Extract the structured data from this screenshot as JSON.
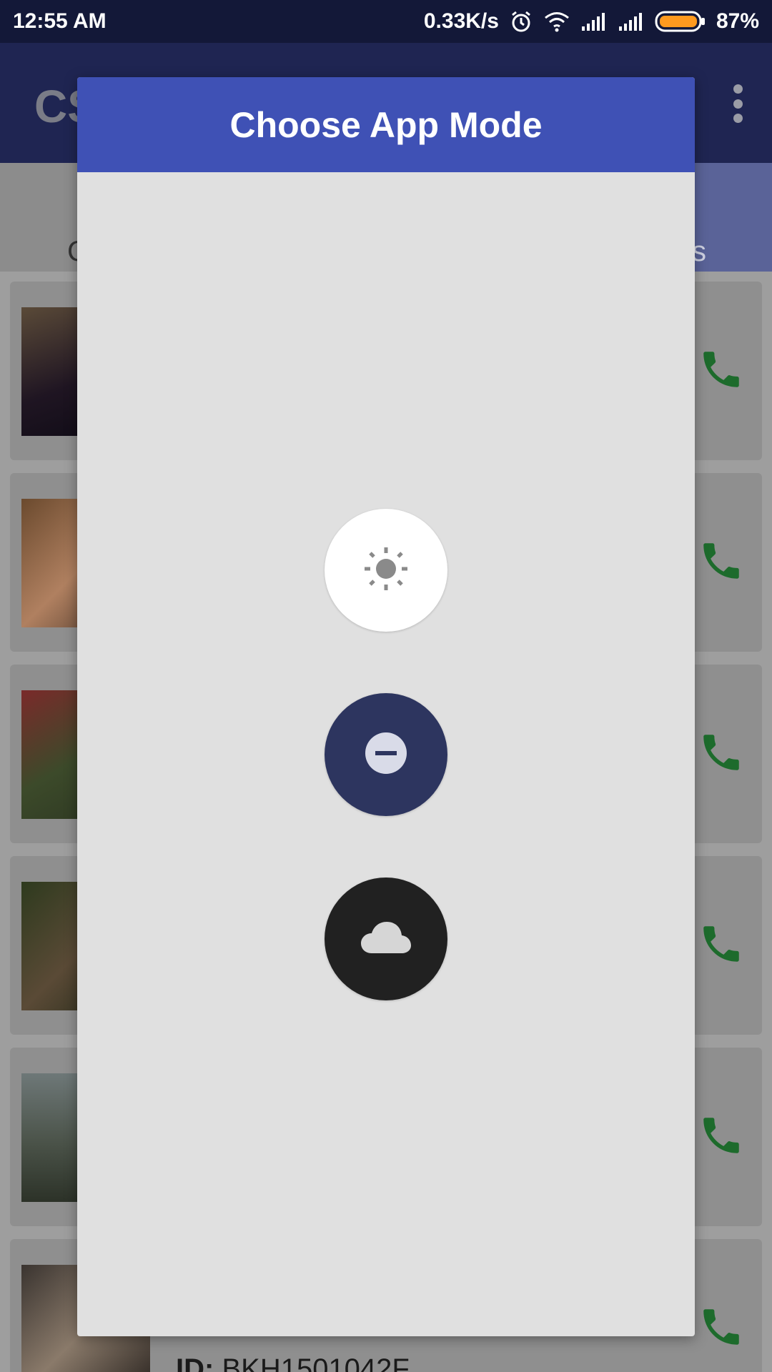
{
  "status_bar": {
    "time": "12:55 AM",
    "speed": "0.33K/s",
    "battery": "87%",
    "icons": [
      "alarm-icon",
      "wifi-icon",
      "signal-icon",
      "signal-icon",
      "battery-icon"
    ]
  },
  "app": {
    "title": "CS",
    "tab_left_fragment": "C",
    "tab_right_fragment": "s",
    "last_contact_id_label": "ID:",
    "last_contact_id_value": "BKH1501042F",
    "call_icon": "phone-icon",
    "accent_color": "#3f51b5",
    "call_color": "#2e7d32"
  },
  "dialog": {
    "title": "Choose App Mode",
    "modes": [
      {
        "name": "light",
        "icon": "sun-icon",
        "background": "#ffffff"
      },
      {
        "name": "do-not-disturb",
        "icon": "minus-circle-icon",
        "background": "#2d355f"
      },
      {
        "name": "dark",
        "icon": "cloud-icon",
        "background": "#212121"
      }
    ]
  }
}
